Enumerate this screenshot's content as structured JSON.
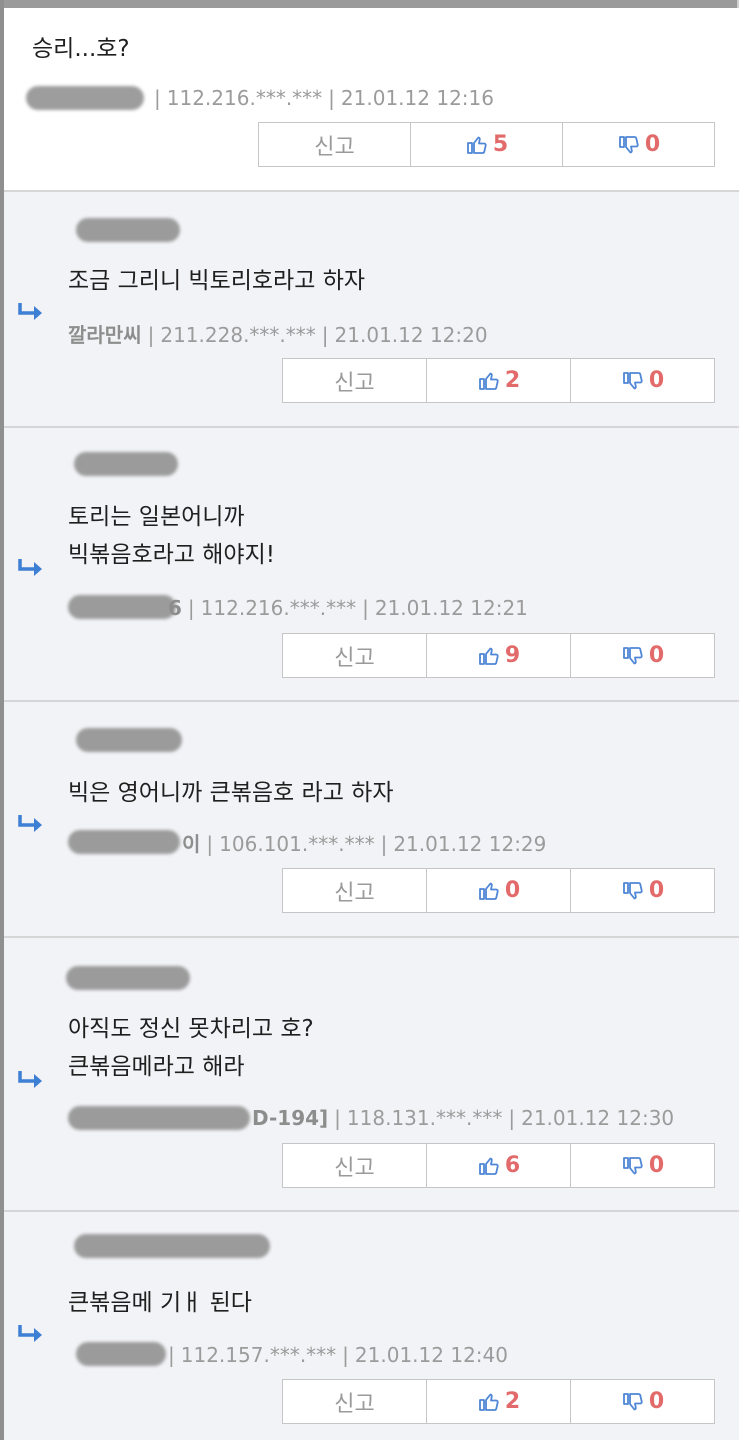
{
  "labels": {
    "report": "신고"
  },
  "icons": {
    "reply": "reply-arrow-icon",
    "up": "thumbs-up-icon",
    "down": "thumbs-down-icon"
  },
  "colors": {
    "count": "#e26a6a",
    "icon": "#4f86d6",
    "reply_bg": "#f2f3f6"
  },
  "comments": [
    {
      "text": "승리...호?",
      "author": "",
      "ip": "112.216.***.***",
      "date": "21.01.12 12:16",
      "up": "5",
      "down": "0"
    },
    {
      "text": "조금 그리니 빅토리호라고 하자",
      "author": "깔라만씨",
      "ip": "211.228.***.***",
      "date": "21.01.12 12:20",
      "up": "2",
      "down": "0"
    },
    {
      "text": "토리는 일본어니까\n빅볶음호라고 해야지!",
      "author": "6",
      "ip": "112.216.***.***",
      "date": "21.01.12 12:21",
      "up": "9",
      "down": "0"
    },
    {
      "text": "빅은 영어니까 큰볶음호 라고 하자",
      "author": "이",
      "ip": "106.101.***.***",
      "date": "21.01.12 12:29",
      "up": "0",
      "down": "0"
    },
    {
      "text": "아직도 정신 못차리고 호?\n큰볶음메라고 해라",
      "author": "D-194]",
      "ip": "118.131.***.***",
      "date": "21.01.12 12:30",
      "up": "6",
      "down": "0"
    },
    {
      "text": "큰볶음메 기ㅐ 된다",
      "author": "",
      "ip": "112.157.***.***",
      "date": "21.01.12 12:40",
      "up": "2",
      "down": "0"
    }
  ]
}
